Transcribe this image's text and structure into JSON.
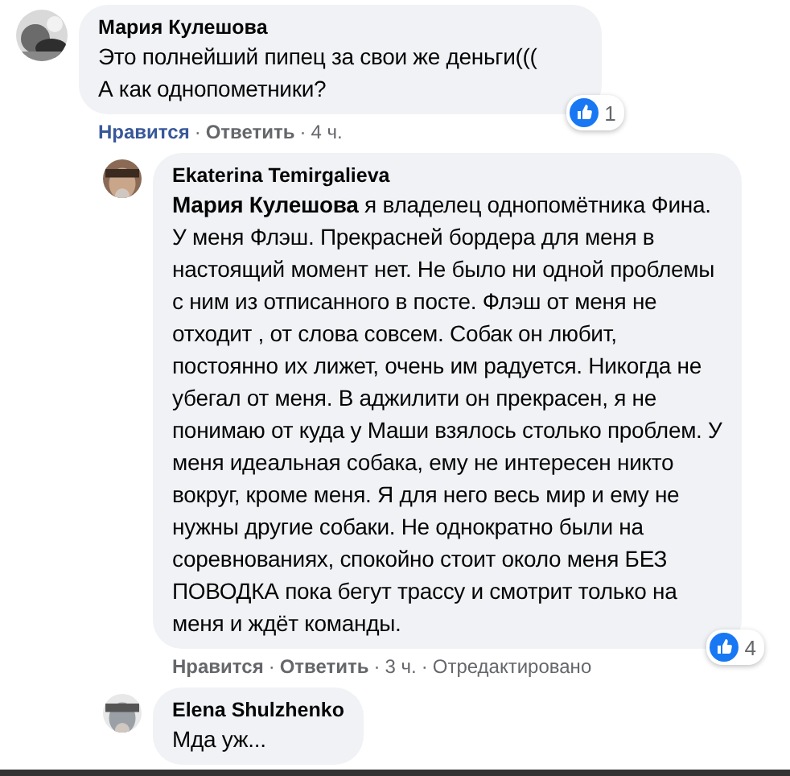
{
  "comments": [
    {
      "author": "Мария Кулешова",
      "text": "Это полнейший пипец за свои же деньги(((\nА как однопометники?",
      "actions": {
        "like": "Нравится",
        "separator": "·",
        "reply": "Ответить",
        "time": "4 ч."
      },
      "liked": true,
      "reactions": "1",
      "replies": [
        {
          "author": "Ekaterina Temirgalieva",
          "text": "**Мария Кулешова** я владелец однопомётника Фина. У меня Флэш. Прекрасней бордера для меня в настоящий момент нет. Не было ни одной проблемы с ним из отписанного в посте. Флэш от меня не отходит , от слова совсем. Собак он любит, постоянно их лижет, очень им радуется. Никогда не убегал от меня. В аджилити он прекрасен, я не понимаю от куда у Маши взялось столько проблем. У меня идеальная собака, ему не интересен никто вокруг, кроме меня. Я для него весь мир и ему не нужны другие собаки. Не однократно были на соревнованиях, спокойно стоит около меня БЕЗ ПОВОДКА пока бегут трассу и смотрит только на меня и ждёт команды.",
          "actions": {
            "like": "Нравится",
            "separator": "·",
            "reply": "Ответить",
            "time": "3 ч.",
            "edited": "Отредактировано"
          },
          "liked": false,
          "reactions": "4"
        },
        {
          "author": "Elena Shulzhenko",
          "text": "Мда уж..."
        }
      ]
    }
  ]
}
